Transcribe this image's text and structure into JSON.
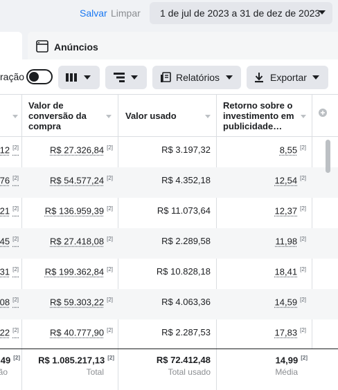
{
  "topbar": {
    "save_label": "Salvar",
    "clear_label": "Limpar",
    "date_range": "1 de jul de 2023 a 31 de dez de 2023"
  },
  "tabs": {
    "ads_label": "Anúncios"
  },
  "toolbar": {
    "comparison_fragment": "ração",
    "reports_label": "Relatórios",
    "export_label": "Exportar"
  },
  "table": {
    "columns": [
      {
        "label": "Valor de conversão da compra"
      },
      {
        "label": "Valor usado"
      },
      {
        "label": "Retorno sobre o investimento em publicidade…"
      }
    ],
    "footnote_marker": "[2]",
    "rows": [
      {
        "left_fragment": "12",
        "conversion_value": "R$ 27.326,84",
        "amount_spent": "R$ 3.197,32",
        "roas": "8,55"
      },
      {
        "left_fragment": "76",
        "conversion_value": "R$ 54.577,24",
        "amount_spent": "R$ 4.352,18",
        "roas": "12,54"
      },
      {
        "left_fragment": "21",
        "conversion_value": "R$ 136.959,39",
        "amount_spent": "R$ 11.073,64",
        "roas": "12,37"
      },
      {
        "left_fragment": "45",
        "conversion_value": "R$ 27.418,08",
        "amount_spent": "R$ 2.289,58",
        "roas": "11,98"
      },
      {
        "left_fragment": "31",
        "conversion_value": "R$ 199.362,84",
        "amount_spent": "R$ 10.828,18",
        "roas": "18,41"
      },
      {
        "left_fragment": "08",
        "conversion_value": "R$ 59.303,22",
        "amount_spent": "R$ 4.063,36",
        "roas": "14,59"
      },
      {
        "left_fragment": "22",
        "conversion_value": "R$ 40.777,90",
        "amount_spent": "R$ 2.287,53",
        "roas": "17,83"
      }
    ],
    "totals": {
      "left_fragment": "49",
      "left_sub_fragment": "ão",
      "conversion_value": "R$ 1.085.217,13",
      "conversion_sub": "Total",
      "amount_spent": "R$ 72.412,48",
      "amount_spent_sub": "Total usado",
      "roas": "14,99",
      "roas_sub": "Média"
    }
  }
}
